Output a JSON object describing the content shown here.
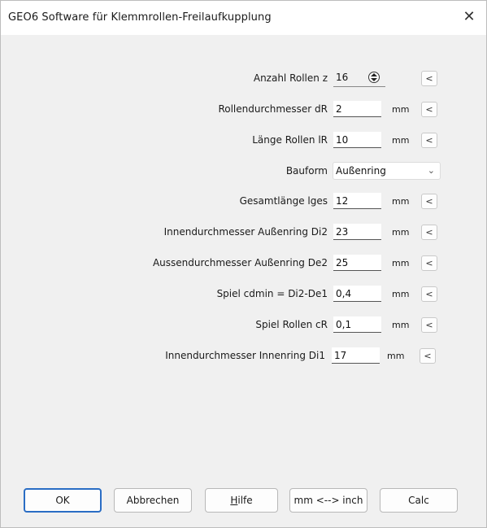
{
  "window": {
    "title": "GEO6  Software für Klemmrollen-Freilaufkupplung",
    "close_glyph": "✕"
  },
  "rows": {
    "r0": {
      "label": "Anzahl Rollen z",
      "value": "16",
      "arrow": "<"
    },
    "r1": {
      "label": "Rollendurchmesser dR",
      "value": "2",
      "unit": "mm",
      "arrow": "<"
    },
    "r2": {
      "label": "Länge Rollen lR",
      "value": "10",
      "unit": "mm",
      "arrow": "<"
    },
    "r3": {
      "label": "Bauform",
      "value": "Außenring"
    },
    "r4": {
      "label": "Gesamtlänge lges",
      "value": "12",
      "unit": "mm",
      "arrow": "<"
    },
    "r5": {
      "label": "Innendurchmesser Außenring Di2",
      "value": "23",
      "unit": "mm",
      "arrow": "<"
    },
    "r6": {
      "label": "Aussendurchmesser Außenring De2",
      "value": "25",
      "unit": "mm",
      "arrow": "<"
    },
    "r7": {
      "label": "Spiel cdmin = Di2-De1",
      "value": "0,4",
      "unit": "mm",
      "arrow": "<"
    },
    "r8": {
      "label": "Spiel Rollen cR",
      "value": "0,1",
      "unit": "mm",
      "arrow": "<"
    },
    "r9": {
      "label": "Innendurchmesser Innenring Di1",
      "value": "17",
      "unit": "mm",
      "arrow": "<"
    }
  },
  "buttons": {
    "ok": "OK",
    "cancel": "Abbrechen",
    "help_mnemonic": "H",
    "help_rest": "ilfe",
    "units": "mm <--> inch",
    "calc": "Calc"
  },
  "colors": {
    "accent": "#2a6dc4",
    "dialog_bg": "#f0f0f0"
  },
  "icons": {
    "spinner": "up-down-spinner-icon",
    "dropdown": "chevron-down-icon",
    "close": "close-icon"
  }
}
